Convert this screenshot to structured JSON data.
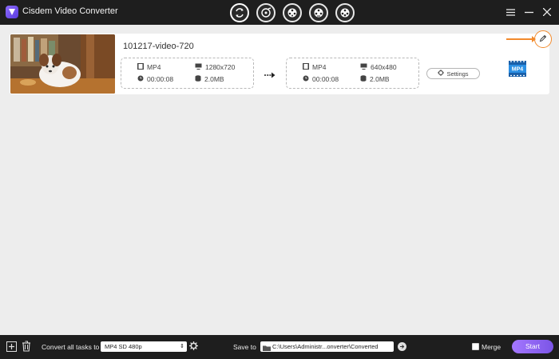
{
  "app": {
    "title": "Cisdem Video Converter"
  },
  "toolbar": {
    "icons": [
      "convert-icon",
      "rip-dvd-icon",
      "download-icon",
      "burn-icon",
      "compress-icon"
    ]
  },
  "task": {
    "file_name": "101217-video-720",
    "source": {
      "format": "MP4",
      "resolution": "1280x720",
      "duration": "00:00:08",
      "size": "2.0MB"
    },
    "output": {
      "format": "MP4",
      "resolution": "640x480",
      "duration": "00:00:08",
      "size": "2.0MB"
    },
    "settings_label": "Settings",
    "format_badge": "MP4"
  },
  "bottom": {
    "convert_all_label": "Convert all tasks to",
    "format_value": "MP4 SD 480p",
    "save_to_label": "Save to",
    "save_path": "C:\\Users\\Administr...onverter\\Converted",
    "merge_label": "Merge",
    "start_label": "Start"
  },
  "colors": {
    "accent": "#8a63f0",
    "highlight": "#f28a2c",
    "bar": "#1e1e1e"
  }
}
